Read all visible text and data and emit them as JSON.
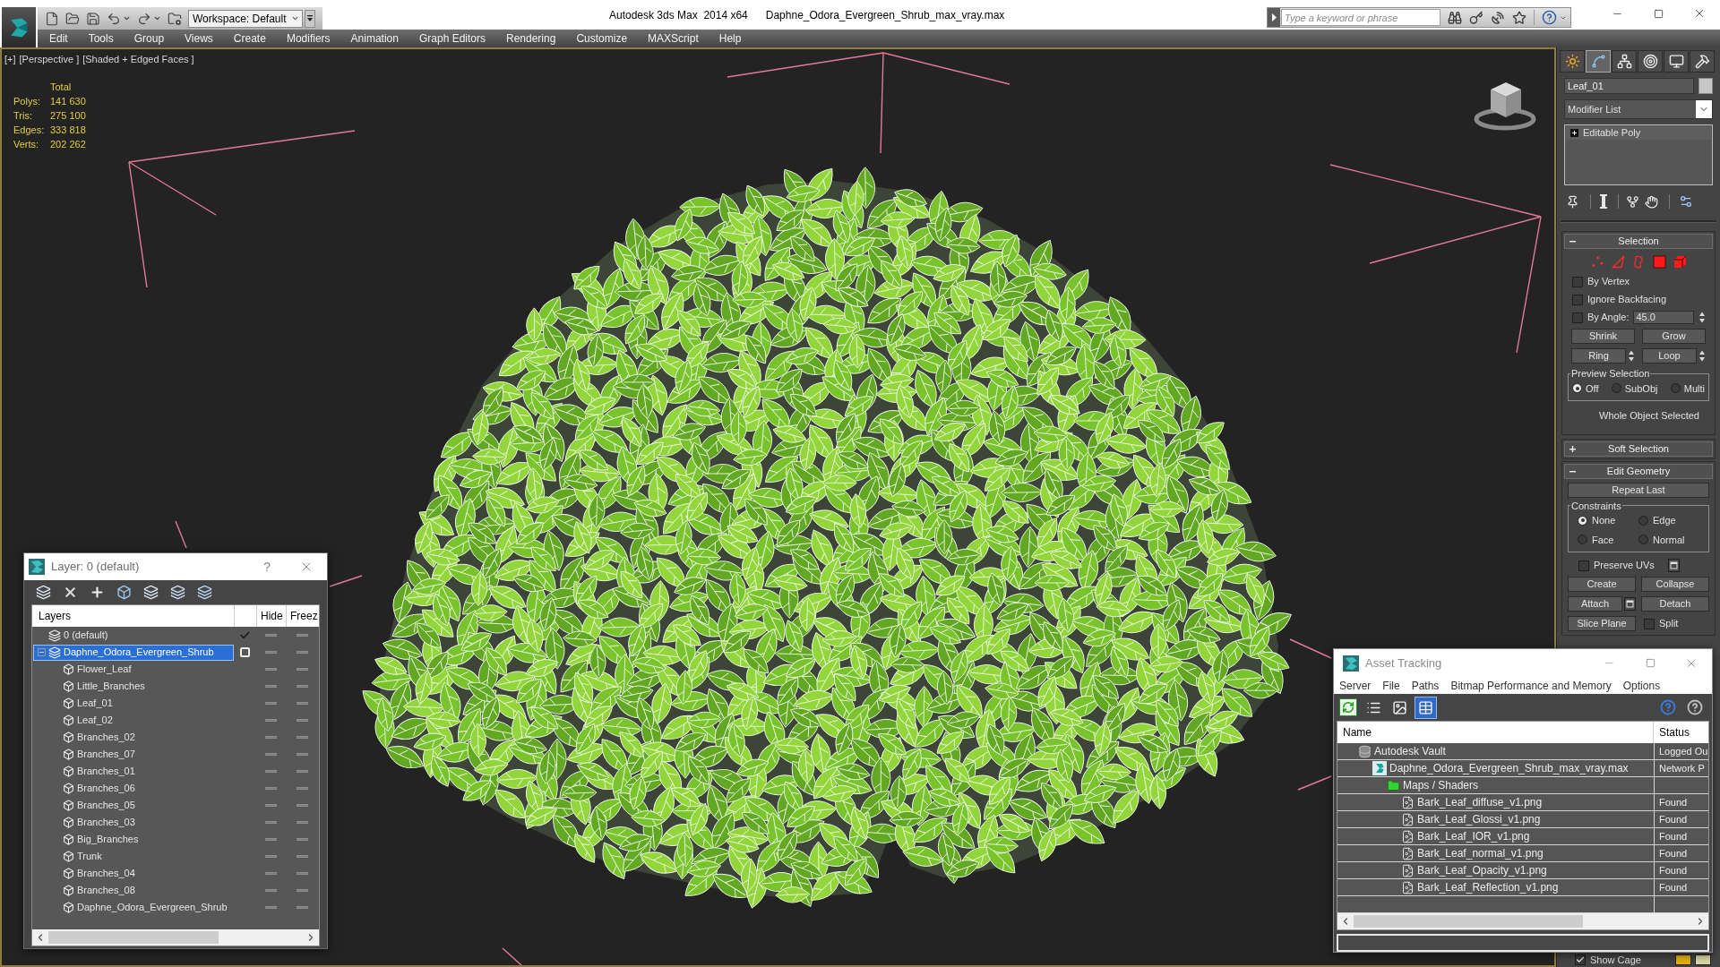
{
  "title_bar": {
    "workspace": "Workspace: Default",
    "app_title": "Autodesk 3ds Max  2014 x64",
    "file_name": "Daphne_Odora_Evergreen_Shrub_max_vray.max",
    "search": {
      "placeholder": "Type a keyword or phrase"
    }
  },
  "menu_bar": [
    "Edit",
    "Tools",
    "Group",
    "Views",
    "Create",
    "Modifiers",
    "Animation",
    "Graph Editors",
    "Rendering",
    "Customize",
    "MAXScript",
    "Help"
  ],
  "viewport": {
    "labels": [
      "[+]",
      "[Perspective ]",
      "[Shaded + Edged Faces ]"
    ],
    "stats": {
      "header": "Total",
      "rows": [
        {
          "label": "Polys:",
          "value": "141 630"
        },
        {
          "label": "Tris:",
          "value": "275 100"
        },
        {
          "label": "Edges:",
          "value": "333 818"
        },
        {
          "label": "Verts:",
          "value": "202 262"
        }
      ]
    }
  },
  "command_panel": {
    "tabs": [
      {
        "kind": "create",
        "selected": false
      },
      {
        "kind": "modify",
        "selected": true
      },
      {
        "kind": "hierarchy",
        "selected": false
      },
      {
        "kind": "motion",
        "selected": false
      },
      {
        "kind": "display",
        "selected": false
      },
      {
        "kind": "utilities",
        "selected": false
      }
    ],
    "object": {
      "name": "Leaf_01",
      "color": "#c8c8c8"
    },
    "modifier_list": "Modifier List",
    "stack": [
      {
        "name": "Editable Poly",
        "expanded": false
      }
    ],
    "selection": {
      "title": "Selection",
      "expanded": true,
      "levels": [
        {
          "kind": "vertex",
          "selected": false
        },
        {
          "kind": "edge",
          "selected": false
        },
        {
          "kind": "border",
          "selected": false
        },
        {
          "kind": "polygon",
          "selected": false
        },
        {
          "kind": "element",
          "selected": false
        }
      ],
      "options": [
        {
          "kind": "checkbox",
          "label": "By Vertex",
          "checked": false
        },
        {
          "kind": "checkbox",
          "label": "Ignore Backfacing",
          "checked": false
        },
        {
          "kind": "angle",
          "label": "By Angle:",
          "checked": false,
          "value": "45.0"
        }
      ],
      "buttons": [
        {
          "kind": "button",
          "label": "Shrink"
        },
        {
          "kind": "button",
          "label": "Grow"
        },
        {
          "kind": "spinner",
          "label": "Ring"
        },
        {
          "kind": "spinner",
          "label": "Loop"
        }
      ],
      "preview": {
        "title": "Preview Selection",
        "options": [
          {
            "label": "Off",
            "selected": true
          },
          {
            "label": "SubObj",
            "selected": false
          },
          {
            "label": "Multi",
            "selected": false
          }
        ]
      },
      "status": "Whole Object Selected"
    },
    "soft_selection": {
      "title": "Soft Selection",
      "expanded": false
    },
    "edit_geometry": {
      "title": "Edit Geometry",
      "expanded": true,
      "repeat_last": "Repeat Last",
      "constraints": {
        "title": "Constraints",
        "options": [
          {
            "label": "None",
            "selected": true
          },
          {
            "label": "Edge",
            "selected": false
          },
          {
            "label": "Face",
            "selected": false
          },
          {
            "label": "Normal",
            "selected": false
          }
        ]
      },
      "preserve_uvs": {
        "label": "Preserve UVs",
        "checked": false
      },
      "buttons": [
        {
          "kind": "button",
          "label": "Create"
        },
        {
          "kind": "button",
          "label": "Collapse"
        },
        {
          "kind": "settings",
          "label": "Attach"
        },
        {
          "kind": "button",
          "label": "Detach"
        },
        {
          "kind": "button",
          "label": "Slice Plane"
        },
        {
          "kind": "checkbox",
          "label": "Split",
          "checked": false
        }
      ]
    },
    "show_cage": {
      "label": "Show Cage",
      "checked": true,
      "swatches": [
        {
          "color": "#e8b100"
        },
        {
          "color": "#d8d8a4"
        }
      ]
    }
  },
  "layer_dialog": {
    "title": "Layer: 0 (default)",
    "help": "?",
    "name_column": "Layers",
    "flag_columns": [
      "Hide",
      "Freez"
    ],
    "layers": [
      {
        "kind": "layer",
        "name": "0 (default)",
        "selected": false,
        "current": true,
        "hidden": false,
        "frozen": false
      },
      {
        "kind": "layer",
        "name": "Daphne_Odora_Evergreen_Shrub",
        "selected": true,
        "current": false,
        "expanded": true,
        "hidden": false,
        "frozen": false,
        "children": [
          {
            "kind": "object",
            "name": "Flower_Leaf",
            "selected": false,
            "hidden": false,
            "frozen": false
          },
          {
            "kind": "object",
            "name": "Little_Branches",
            "selected": false,
            "hidden": false,
            "frozen": false
          },
          {
            "kind": "object",
            "name": "Leaf_01",
            "selected": false,
            "hidden": false,
            "frozen": false
          },
          {
            "kind": "object",
            "name": "Leaf_02",
            "selected": false,
            "hidden": false,
            "frozen": false
          },
          {
            "kind": "object",
            "name": "Branches_02",
            "selected": false,
            "hidden": false,
            "frozen": false
          },
          {
            "kind": "object",
            "name": "Branches_07",
            "selected": false,
            "hidden": false,
            "frozen": false
          },
          {
            "kind": "object",
            "name": "Branches_01",
            "selected": false,
            "hidden": false,
            "frozen": false
          },
          {
            "kind": "object",
            "name": "Branches_06",
            "selected": false,
            "hidden": false,
            "frozen": false
          },
          {
            "kind": "object",
            "name": "Branches_05",
            "selected": false,
            "hidden": false,
            "frozen": false
          },
          {
            "kind": "object",
            "name": "Branches_03",
            "selected": false,
            "hidden": false,
            "frozen": false
          },
          {
            "kind": "object",
            "name": "Big_Branches",
            "selected": false,
            "hidden": false,
            "frozen": false
          },
          {
            "kind": "object",
            "name": "Trunk",
            "selected": false,
            "hidden": false,
            "frozen": false
          },
          {
            "kind": "object",
            "name": "Branches_04",
            "selected": false,
            "hidden": false,
            "frozen": false
          },
          {
            "kind": "object",
            "name": "Branches_08",
            "selected": false,
            "hidden": false,
            "frozen": false
          },
          {
            "kind": "object",
            "name": "Daphne_Odora_Evergreen_Shrub",
            "selected": false,
            "hidden": false,
            "frozen": false
          }
        ]
      }
    ]
  },
  "asset_tracking": {
    "title": "Asset Tracking",
    "menu": [
      "Server",
      "File",
      "Paths",
      "Bitmap Performance and Memory",
      "Options"
    ],
    "views": [
      {
        "kind": "list",
        "selected": false
      },
      {
        "kind": "thumbnails",
        "selected": false
      },
      {
        "kind": "table",
        "selected": true
      }
    ],
    "columns": [
      "Name",
      "Status"
    ],
    "assets": [
      {
        "kind": "vault",
        "name": "Autodesk Vault",
        "status": "Logged Ou",
        "selected": false,
        "children": [
          {
            "kind": "scene",
            "name": "Daphne_Odora_Evergreen_Shrub_max_vray.max",
            "status": "Network P",
            "selected": false,
            "children": [
              {
                "kind": "maps",
                "name": "Maps / Shaders",
                "selected": false,
                "children": [
                  {
                    "kind": "bitmap",
                    "name": "Bark_Leaf_diffuse_v1.png",
                    "status": "Found",
                    "selected": false
                  },
                  {
                    "kind": "bitmap",
                    "name": "Bark_Leaf_Glossi_v1.png",
                    "status": "Found",
                    "selected": false
                  },
                  {
                    "kind": "bitmap",
                    "name": "Bark_Leaf_IOR_v1.png",
                    "status": "Found",
                    "selected": false
                  },
                  {
                    "kind": "bitmap",
                    "name": "Bark_Leaf_normal_v1.png",
                    "status": "Found",
                    "selected": false
                  },
                  {
                    "kind": "bitmap",
                    "name": "Bark_Leaf_Opacity_v1.png",
                    "status": "Found",
                    "selected": false
                  },
                  {
                    "kind": "bitmap",
                    "name": "Bark_Leaf_Reflection_v1.png",
                    "status": "Found",
                    "selected": false
                  }
                ]
              }
            ]
          }
        ]
      }
    ]
  }
}
